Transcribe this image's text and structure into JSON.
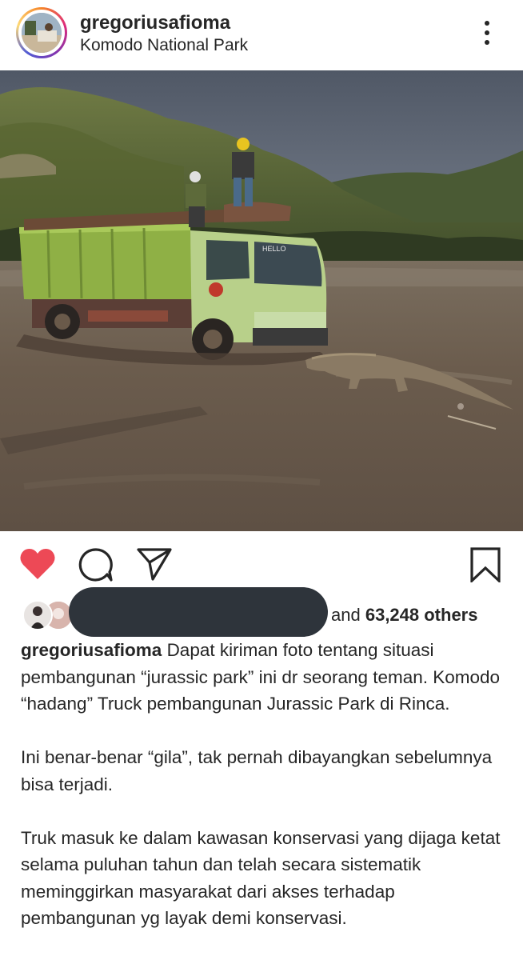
{
  "post": {
    "username": "gregoriusafioma",
    "location": "Komodo National Park"
  },
  "photo": {
    "alt": "Komodo dragon blocking a green dump truck on a muddy construction site"
  },
  "truck": {
    "cab_text": "HELLO"
  },
  "actions": {
    "like_color": "#ed4956"
  },
  "likes": {
    "and_text": "and",
    "count_text": "63,248 others"
  },
  "caption": {
    "username": "gregoriusafioma",
    "first_line": "Dapat kiriman foto  tentang situasi pembangunan “jurassic park” ini dr seorang teman. Komodo “hadang” Truck pembangunan Jurassic Park di Rinca.",
    "paragraph_2": "Ini benar-benar “gila”, tak pernah dibayangkan sebelumnya bisa terjadi.",
    "paragraph_3": "Truk masuk ke dalam kawasan konservasi yang dijaga ketat selama puluhan tahun dan telah secara sistematik meminggirkan masyarakat dari akses terhadap pembangunan yg layak demi konservasi."
  }
}
